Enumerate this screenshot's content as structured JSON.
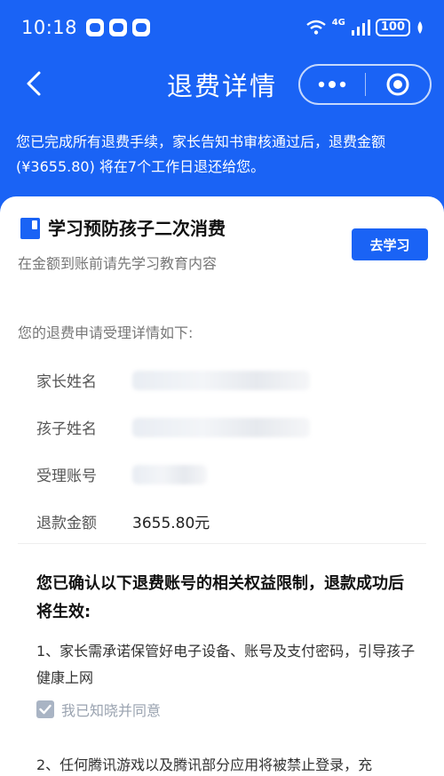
{
  "status_bar": {
    "time": "10:18",
    "network": "4G",
    "battery": "100"
  },
  "header": {
    "title": "退费详情"
  },
  "notice": "您已完成所有退费手续，家长告知书审核通过后，退费金额(¥3655.80) 将在7个工作日退还给您。",
  "learn": {
    "title": "学习预防孩子二次消费",
    "subtitle": "在金额到账前请先学习教育内容",
    "button": "去学习"
  },
  "apply_intro": "您的退费申请受理详情如下:",
  "details": [
    {
      "label": "家长姓名",
      "value": ""
    },
    {
      "label": "孩子姓名",
      "value": ""
    },
    {
      "label": "受理账号",
      "value": ""
    },
    {
      "label": "退款金额",
      "value": "3655.80元"
    }
  ],
  "confirm_title": "您已确认以下退费账号的相关权益限制，退款成功后将生效:",
  "items": [
    "1、家长需承诺保管好电子设备、账号及支付密码，引导孩子健康上网",
    "2、任何腾讯游戏以及腾讯部分应用将被禁止登录，充"
  ],
  "agree_label": "我已知晓并同意",
  "colors": {
    "primary": "#1a63f5",
    "card_bg": "#ffffff"
  }
}
